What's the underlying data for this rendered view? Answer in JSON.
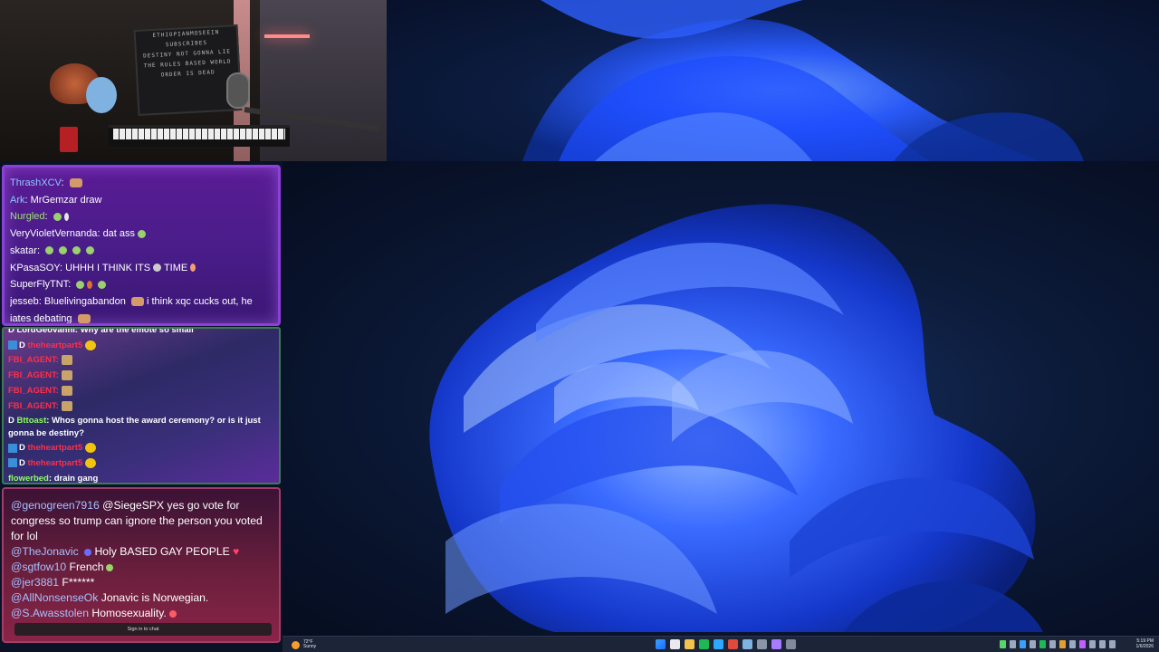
{
  "webcam": {
    "sign_lines": [
      "ETHIOPIANMOSEEIN",
      "SUBSCRIBES",
      "DESTINY NOT GONNA LIE",
      "THE RULES BASED WORLD",
      "ORDER IS DEAD"
    ]
  },
  "chat1": {
    "messages": [
      {
        "user": "ThrashXCV",
        "text": "",
        "user_color": "#8ec8ff"
      },
      {
        "user": "Ark",
        "text": "MrGemzar draw",
        "user_color": "#8ec8ff"
      },
      {
        "user": "Nurgled",
        "text": "",
        "user_color": "#9be36d"
      },
      {
        "user": "VeryVioletVernanda",
        "text": "dat ass",
        "user_color": "#ffffff"
      },
      {
        "user": "skatar",
        "text": "",
        "user_color": "#ffffff"
      },
      {
        "user": "KPasaSOY",
        "text": "UHHH I THINK ITS",
        "text2": "TIME",
        "user_color": "#ffffff"
      },
      {
        "user": "SuperFlyTNT",
        "text": "",
        "user_color": "#ffffff"
      },
      {
        "user": "jesseb",
        "text": "Bluelivingabandon",
        "text2": "i think xqc cucks out, he",
        "text3": "iates debating",
        "user_color": "#ffffff"
      }
    ]
  },
  "chat2": {
    "top_cut": "D LordGeovanni: Why are the emote so small",
    "messages": [
      {
        "prefix": "D",
        "user": "theheartpart5",
        "text": "",
        "user_class": "red",
        "badge": true
      },
      {
        "prefix": "",
        "user": "FBI_AGENT",
        "text": "",
        "user_class": "red"
      },
      {
        "prefix": "",
        "user": "FBI_AGENT",
        "text": "",
        "user_class": "red"
      },
      {
        "prefix": "",
        "user": "FBI_AGENT",
        "text": "",
        "user_class": "red"
      },
      {
        "prefix": "",
        "user": "FBI_AGENT",
        "text": "",
        "user_class": "red"
      }
    ],
    "long_msg": {
      "prefix": "D",
      "user": "Bttoast",
      "text": "Whos gonna host the award ceremony? or is it just gonna be destiny?"
    },
    "tail": [
      {
        "prefix": "D",
        "user": "theheartpart5",
        "user_class": "red",
        "badge": true
      },
      {
        "prefix": "D",
        "user": "theheartpart5",
        "user_class": "red",
        "badge": true
      }
    ],
    "last": {
      "user": "flowerbed",
      "text": "drain gang"
    }
  },
  "chat3": {
    "messages": [
      {
        "user": "@genogreen7916",
        "text": "@SiegeSPX yes go vote for congress so trump can ignore the person you voted for lol"
      },
      {
        "user": "@TheJonavic",
        "text": "Holy BASED GAY PEOPLE",
        "heart": "♥"
      },
      {
        "user": "@sgtfow10",
        "text": "French"
      },
      {
        "user": "@jer3881",
        "text": "F******"
      },
      {
        "user": "@AllNonsenseOk",
        "text": "Jonavic is Norwegian."
      },
      {
        "user": "@S.Awasstolen",
        "text": "Homosexuality."
      }
    ],
    "signin_label": "Sign in to chat"
  },
  "taskbar": {
    "weather_temp": "72°F",
    "weather_desc": "Sunny",
    "clock_time": "5:19 PM",
    "clock_date": "1/6/2026",
    "center_icons": [
      "windows-start-icon",
      "file-explorer-icon",
      "taskview-icon",
      "spotify-icon",
      "edge-icon",
      "chrome-icon",
      "folder-icon",
      "settings-icon",
      "app-icon",
      "terminal-icon"
    ],
    "center_colors": [
      "#3aa0ff",
      "#e9e9ef",
      "#f2c14e",
      "#1db954",
      "#2ea8ff",
      "#e04a3c",
      "#7fb2e0",
      "#8a95aa",
      "#a77cff",
      "#808a9c"
    ]
  }
}
